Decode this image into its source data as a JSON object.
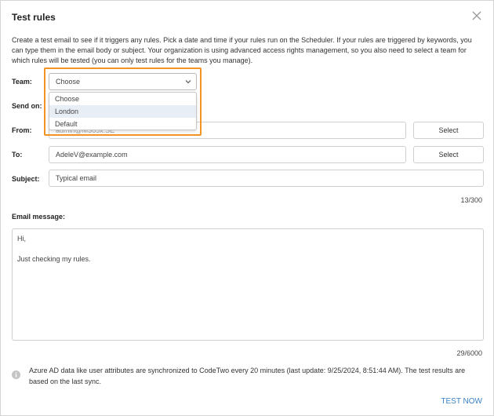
{
  "dialog": {
    "title": "Test rules",
    "description": "Create a test email to see if it triggers any rules. Pick a date and time if your rules run on the Scheduler. If your rules are triggered by keywords, you can type them in the email body or subject. Your organization is using advanced access rights management, so you also need to select a team for which rules will be tested (you can only test rules for the teams you manage)."
  },
  "team": {
    "label": "Team:",
    "selected": "Choose",
    "options": [
      "Choose",
      "London",
      "Default"
    ],
    "highlighted_option": "London"
  },
  "send_on": {
    "label": "Send on:"
  },
  "from": {
    "label": "From:",
    "value": "admin@M365x.SE",
    "select_label": "Select"
  },
  "to": {
    "label": "To:",
    "value": "AdeleV@example.com",
    "select_label": "Select"
  },
  "subject": {
    "label": "Subject:",
    "value": "Typical email",
    "counter": "13/300"
  },
  "message": {
    "label": "Email message:",
    "body": "Hi,\n\nJust checking my rules.",
    "counter": "29/6000"
  },
  "info": {
    "icon": "info-icon",
    "text": "Azure AD data like user attributes are synchronized to CodeTwo every 20 minutes (last update: 9/25/2024, 8:51:44 AM). The test results are based on the last sync."
  },
  "actions": {
    "test_now": "TEST NOW"
  },
  "colors": {
    "accent": "#3b82c4",
    "highlight": "#f39324",
    "option_hover": "#e8eef6"
  }
}
